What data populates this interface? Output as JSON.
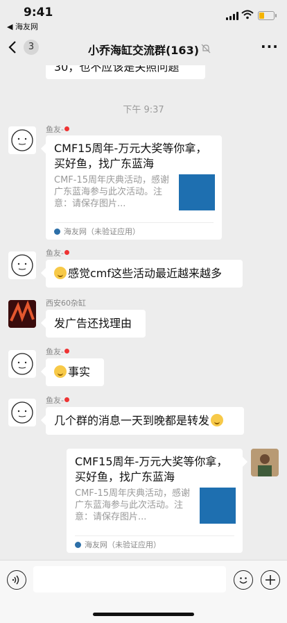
{
  "status": {
    "time": "9:41",
    "back_app": "◀ 海友网"
  },
  "nav": {
    "unread": "3",
    "title": "小乔海缸交流群(163)"
  },
  "top_message": "30，也不应该是关照问题",
  "time_separator": "下午 9:37",
  "messages": [
    {
      "sender": "鱼友-",
      "type": "card",
      "title": "CMF15周年-万元大奖等你拿，买好鱼，找广东蓝海",
      "desc": "CMF-15周年庆典活动，感谢广东蓝海参与此次活动。注意：请保存图片...",
      "source": "海友网（未验证应用）"
    },
    {
      "sender": "鱼友-",
      "text": "感觉cmf这些活动最近越来越多"
    },
    {
      "sender": "西安60杂缸",
      "text": "发广告还找理由"
    },
    {
      "sender": "鱼友-",
      "text": "事实"
    },
    {
      "sender": "鱼友-",
      "text": "几个群的消息一天到晚都是转发"
    },
    {
      "type": "card",
      "title": "CMF15周年-万元大奖等你拿，买好鱼，找广东蓝海",
      "desc": "CMF-15周年庆典活动，感谢广东蓝海参与此次活动。注意：请保存图片...",
      "source": "海友网（未验证应用）"
    }
  ],
  "icons": {
    "back": "chevron-left-icon",
    "mute": "bell-muted-icon",
    "more": "more-icon",
    "voice": "voice-icon",
    "emoji": "emoji-icon",
    "plus": "plus-icon"
  }
}
